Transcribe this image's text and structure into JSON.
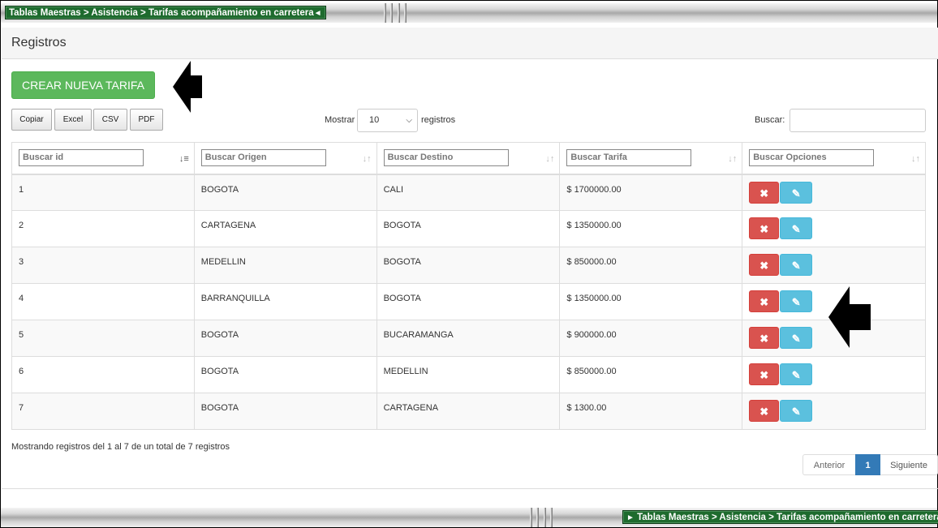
{
  "breadcrumb": {
    "text": "Tablas Maestras > Asistencia > Tarifas acompañamiento en carretera",
    "top_triangle": "◄",
    "bottom_triangle": "►"
  },
  "panel": {
    "title": "Registros"
  },
  "create_button": "CREAR NUEVA TARIFA",
  "export_buttons": [
    "Copiar",
    "Excel",
    "CSV",
    "PDF"
  ],
  "length_menu": {
    "before": "Mostrar",
    "value": "10",
    "after": "registros"
  },
  "search": {
    "label": "Buscar:",
    "value": ""
  },
  "columns": [
    {
      "filter_placeholder": "Buscar id"
    },
    {
      "filter_placeholder": "Buscar Origen"
    },
    {
      "filter_placeholder": "Buscar Destino"
    },
    {
      "filter_placeholder": "Buscar Tarifa"
    },
    {
      "filter_placeholder": "Buscar Opciones"
    }
  ],
  "rows": [
    {
      "id": "1",
      "origen": "BOGOTA",
      "destino": "CALI",
      "tarifa": "$ 1700000.00"
    },
    {
      "id": "2",
      "origen": "CARTAGENA",
      "destino": "BOGOTA",
      "tarifa": "$ 1350000.00"
    },
    {
      "id": "3",
      "origen": "MEDELLIN",
      "destino": "BOGOTA",
      "tarifa": "$ 850000.00"
    },
    {
      "id": "4",
      "origen": "BARRANQUILLA",
      "destino": "BOGOTA",
      "tarifa": "$ 1350000.00"
    },
    {
      "id": "5",
      "origen": "BOGOTA",
      "destino": "BUCARAMANGA",
      "tarifa": "$ 900000.00"
    },
    {
      "id": "6",
      "origen": "BOGOTA",
      "destino": "MEDELLIN",
      "tarifa": "$ 850000.00"
    },
    {
      "id": "7",
      "origen": "BOGOTA",
      "destino": "CARTAGENA",
      "tarifa": "$ 1300.00"
    }
  ],
  "row_actions": {
    "delete_icon": "times-icon",
    "edit_icon": "pencil-square-icon"
  },
  "summary": "Mostrando registros del 1 al 7 de un total de 7 registros",
  "pagination": {
    "prev": "Anterior",
    "current": "1",
    "next": "Siguiente"
  },
  "colors": {
    "success": "#5cb85c",
    "danger": "#d9534f",
    "info": "#5bc0de",
    "primary": "#337ab7",
    "breadcrumb": "#1e6b2e"
  }
}
